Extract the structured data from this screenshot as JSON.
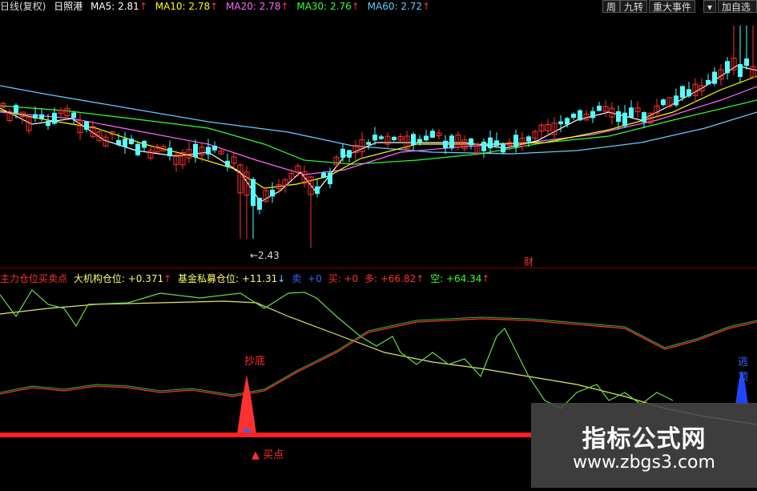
{
  "header": {
    "period_label": "日线(复权)",
    "stock_name": "日照港",
    "ma": [
      {
        "label": "MA5: 2.81",
        "color": "#ffffff"
      },
      {
        "label": "MA10: 2.78",
        "color": "#ffff00"
      },
      {
        "label": "MA20: 2.78",
        "color": "#ff66ff"
      },
      {
        "label": "MA30: 2.76",
        "color": "#33ff33"
      },
      {
        "label": "MA60: 2.72",
        "color": "#66ccff"
      }
    ],
    "up_arrow": "↑",
    "buttons": [
      "周",
      "九转",
      "重大事件",
      "▾",
      "加自选"
    ]
  },
  "price_panel": {
    "low_label": "←2.43",
    "marker": "财"
  },
  "indicator": {
    "name": "主力仓位买卖点",
    "items": [
      {
        "label": "大机构仓位: +0.371",
        "arrow": "↑",
        "color": "#ffff66",
        "arrow_color": "#ff3030"
      },
      {
        "label": "基金私募仓位: +11.31",
        "arrow": "↓",
        "color": "#ffff66",
        "arrow_color": "#66ccff"
      },
      {
        "label": "卖",
        "arrow": "",
        "color": "#3366ff",
        "arrow_color": ""
      },
      {
        "label": "+0",
        "arrow": "",
        "color": "#3366ff",
        "arrow_color": ""
      },
      {
        "label": "买: +0",
        "arrow": "",
        "color": "#ff3030",
        "arrow_color": ""
      },
      {
        "label": "多: +66.82",
        "arrow": "↑",
        "color": "#ff3030",
        "arrow_color": "#ff3030"
      },
      {
        "label": "空: +64.34",
        "arrow": "↑",
        "color": "#33ff33",
        "arrow_color": "#ff3030"
      }
    ],
    "annotations": {
      "chaodi": "抄底",
      "buy_point": "▲ 买点",
      "escape": "逃顶"
    }
  },
  "watermark": {
    "line1": "指标公式网",
    "line2": "www.zbgs3.com"
  },
  "colors": {
    "up": "#ff3030",
    "down": "#54ffff",
    "background": "#000000"
  },
  "chart_data": {
    "type": "candlestick",
    "series": [
      {
        "name": "MA5",
        "color": "#ffffff"
      },
      {
        "name": "MA10",
        "color": "#ffff00"
      },
      {
        "name": "MA20",
        "color": "#ff66ff"
      },
      {
        "name": "MA30",
        "color": "#33ff33"
      },
      {
        "name": "MA60",
        "color": "#66ccff"
      }
    ],
    "price_range": [
      2.4,
      3.55
    ],
    "lowest_marked": 2.43,
    "indicator_range": [
      0,
      100
    ]
  }
}
